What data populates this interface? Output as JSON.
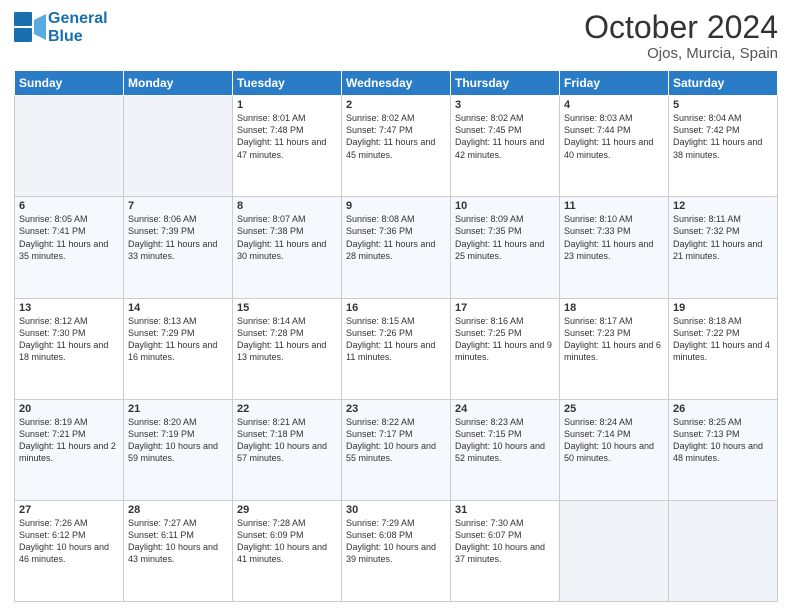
{
  "header": {
    "logo_line1": "General",
    "logo_line2": "Blue",
    "month_title": "October 2024",
    "location": "Ojos, Murcia, Spain"
  },
  "columns": [
    "Sunday",
    "Monday",
    "Tuesday",
    "Wednesday",
    "Thursday",
    "Friday",
    "Saturday"
  ],
  "weeks": [
    [
      {
        "day": "",
        "info": ""
      },
      {
        "day": "",
        "info": ""
      },
      {
        "day": "1",
        "info": "Sunrise: 8:01 AM\nSunset: 7:48 PM\nDaylight: 11 hours and 47 minutes."
      },
      {
        "day": "2",
        "info": "Sunrise: 8:02 AM\nSunset: 7:47 PM\nDaylight: 11 hours and 45 minutes."
      },
      {
        "day": "3",
        "info": "Sunrise: 8:02 AM\nSunset: 7:45 PM\nDaylight: 11 hours and 42 minutes."
      },
      {
        "day": "4",
        "info": "Sunrise: 8:03 AM\nSunset: 7:44 PM\nDaylight: 11 hours and 40 minutes."
      },
      {
        "day": "5",
        "info": "Sunrise: 8:04 AM\nSunset: 7:42 PM\nDaylight: 11 hours and 38 minutes."
      }
    ],
    [
      {
        "day": "6",
        "info": "Sunrise: 8:05 AM\nSunset: 7:41 PM\nDaylight: 11 hours and 35 minutes."
      },
      {
        "day": "7",
        "info": "Sunrise: 8:06 AM\nSunset: 7:39 PM\nDaylight: 11 hours and 33 minutes."
      },
      {
        "day": "8",
        "info": "Sunrise: 8:07 AM\nSunset: 7:38 PM\nDaylight: 11 hours and 30 minutes."
      },
      {
        "day": "9",
        "info": "Sunrise: 8:08 AM\nSunset: 7:36 PM\nDaylight: 11 hours and 28 minutes."
      },
      {
        "day": "10",
        "info": "Sunrise: 8:09 AM\nSunset: 7:35 PM\nDaylight: 11 hours and 25 minutes."
      },
      {
        "day": "11",
        "info": "Sunrise: 8:10 AM\nSunset: 7:33 PM\nDaylight: 11 hours and 23 minutes."
      },
      {
        "day": "12",
        "info": "Sunrise: 8:11 AM\nSunset: 7:32 PM\nDaylight: 11 hours and 21 minutes."
      }
    ],
    [
      {
        "day": "13",
        "info": "Sunrise: 8:12 AM\nSunset: 7:30 PM\nDaylight: 11 hours and 18 minutes."
      },
      {
        "day": "14",
        "info": "Sunrise: 8:13 AM\nSunset: 7:29 PM\nDaylight: 11 hours and 16 minutes."
      },
      {
        "day": "15",
        "info": "Sunrise: 8:14 AM\nSunset: 7:28 PM\nDaylight: 11 hours and 13 minutes."
      },
      {
        "day": "16",
        "info": "Sunrise: 8:15 AM\nSunset: 7:26 PM\nDaylight: 11 hours and 11 minutes."
      },
      {
        "day": "17",
        "info": "Sunrise: 8:16 AM\nSunset: 7:25 PM\nDaylight: 11 hours and 9 minutes."
      },
      {
        "day": "18",
        "info": "Sunrise: 8:17 AM\nSunset: 7:23 PM\nDaylight: 11 hours and 6 minutes."
      },
      {
        "day": "19",
        "info": "Sunrise: 8:18 AM\nSunset: 7:22 PM\nDaylight: 11 hours and 4 minutes."
      }
    ],
    [
      {
        "day": "20",
        "info": "Sunrise: 8:19 AM\nSunset: 7:21 PM\nDaylight: 11 hours and 2 minutes."
      },
      {
        "day": "21",
        "info": "Sunrise: 8:20 AM\nSunset: 7:19 PM\nDaylight: 10 hours and 59 minutes."
      },
      {
        "day": "22",
        "info": "Sunrise: 8:21 AM\nSunset: 7:18 PM\nDaylight: 10 hours and 57 minutes."
      },
      {
        "day": "23",
        "info": "Sunrise: 8:22 AM\nSunset: 7:17 PM\nDaylight: 10 hours and 55 minutes."
      },
      {
        "day": "24",
        "info": "Sunrise: 8:23 AM\nSunset: 7:15 PM\nDaylight: 10 hours and 52 minutes."
      },
      {
        "day": "25",
        "info": "Sunrise: 8:24 AM\nSunset: 7:14 PM\nDaylight: 10 hours and 50 minutes."
      },
      {
        "day": "26",
        "info": "Sunrise: 8:25 AM\nSunset: 7:13 PM\nDaylight: 10 hours and 48 minutes."
      }
    ],
    [
      {
        "day": "27",
        "info": "Sunrise: 7:26 AM\nSunset: 6:12 PM\nDaylight: 10 hours and 46 minutes."
      },
      {
        "day": "28",
        "info": "Sunrise: 7:27 AM\nSunset: 6:11 PM\nDaylight: 10 hours and 43 minutes."
      },
      {
        "day": "29",
        "info": "Sunrise: 7:28 AM\nSunset: 6:09 PM\nDaylight: 10 hours and 41 minutes."
      },
      {
        "day": "30",
        "info": "Sunrise: 7:29 AM\nSunset: 6:08 PM\nDaylight: 10 hours and 39 minutes."
      },
      {
        "day": "31",
        "info": "Sunrise: 7:30 AM\nSunset: 6:07 PM\nDaylight: 10 hours and 37 minutes."
      },
      {
        "day": "",
        "info": ""
      },
      {
        "day": "",
        "info": ""
      }
    ]
  ]
}
